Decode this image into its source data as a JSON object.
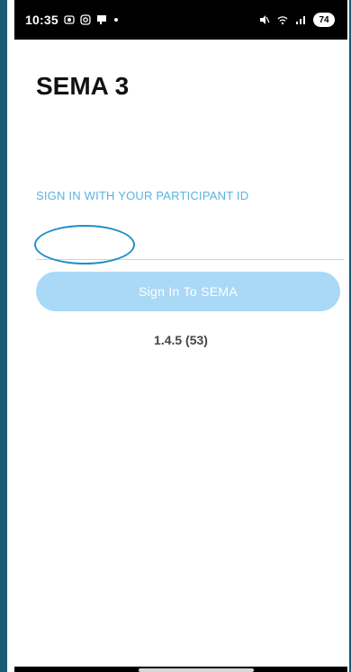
{
  "status_bar": {
    "time": "10:35",
    "battery": "74",
    "icons": [
      "screenshot-icon",
      "instagram-icon",
      "notification-icon",
      "dot-icon",
      "mute-icon",
      "wifi-icon",
      "signal-icon"
    ]
  },
  "app": {
    "title": "SEMA 3"
  },
  "login": {
    "label": "SIGN IN WITH YOUR PARTICIPANT ID",
    "participant_id_value": "",
    "button_label": "Sign In To SEMA"
  },
  "footer": {
    "version": "1.4.5 (53)"
  },
  "colors": {
    "accent": "#5bb2e0",
    "button_disabled": "#a9d9f6",
    "annotation": "#1f8fc8"
  }
}
